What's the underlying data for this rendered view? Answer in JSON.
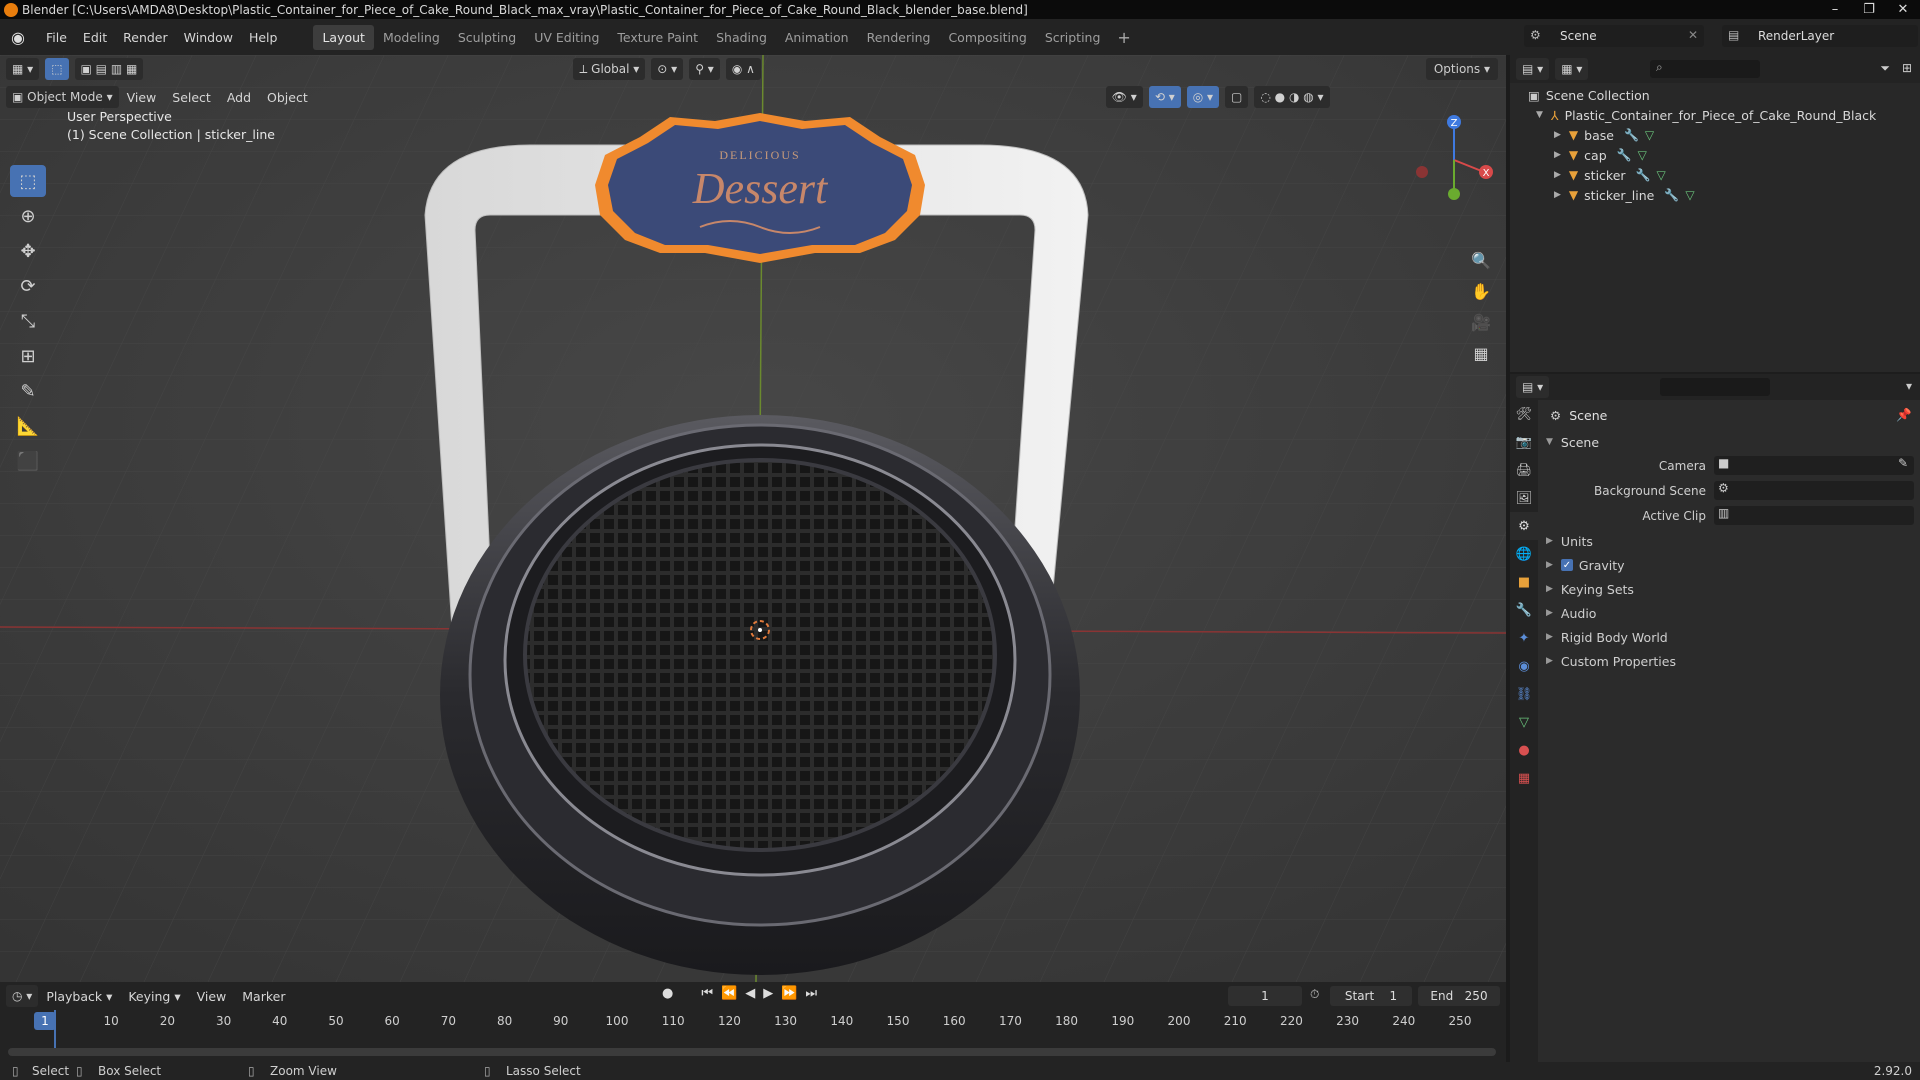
{
  "window": {
    "title": "Blender [C:\\Users\\AMDA8\\Desktop\\Plastic_Container_for_Piece_of_Cake_Round_Black_max_vray\\Plastic_Container_for_Piece_of_Cake_Round_Black_blender_base.blend]",
    "minimize": "–",
    "maximize": "❐",
    "close": "✕"
  },
  "menubar": {
    "items": [
      "File",
      "Edit",
      "Render",
      "Window",
      "Help"
    ],
    "workspaces": [
      "Layout",
      "Modeling",
      "Sculpting",
      "UV Editing",
      "Texture Paint",
      "Shading",
      "Animation",
      "Rendering",
      "Compositing",
      "Scripting"
    ],
    "add_workspace": "+",
    "scene": "Scene",
    "render_layer": "RenderLayer"
  },
  "viewport": {
    "mode": "Object Mode",
    "menus": [
      "View",
      "Select",
      "Add",
      "Object"
    ],
    "transform_orientation": "Global",
    "options": "Options",
    "info_line1": "User Perspective",
    "info_line2": "(1) Scene Collection | sticker_line",
    "sticker_top": "DELICIOUS",
    "sticker_main": "Dessert",
    "gizmo": {
      "z": "Z",
      "x": "X"
    }
  },
  "outliner": {
    "root": "Scene Collection",
    "collection": "Plastic_Container_for_Piece_of_Cake_Round_Black",
    "objects": [
      "base",
      "cap",
      "sticker",
      "sticker_line"
    ]
  },
  "properties": {
    "title": "Scene",
    "section": "Scene",
    "fields": [
      {
        "label": "Camera"
      },
      {
        "label": "Background Scene"
      },
      {
        "label": "Active Clip"
      }
    ],
    "subsections": [
      "Units",
      "Gravity",
      "Keying Sets",
      "Audio",
      "Rigid Body World",
      "Custom Properties"
    ],
    "gravity_checked": true
  },
  "timeline": {
    "menus": [
      "Playback",
      "Keying",
      "View",
      "Marker"
    ],
    "current_frame": "1",
    "start_label": "Start",
    "start": "1",
    "end_label": "End",
    "end": "250",
    "ruler": [
      "10",
      "20",
      "30",
      "40",
      "50",
      "60",
      "70",
      "80",
      "90",
      "100",
      "110",
      "120",
      "130",
      "140",
      "150",
      "160",
      "170",
      "180",
      "190",
      "200",
      "210",
      "220",
      "230",
      "240",
      "250"
    ],
    "cursor_frame": "1"
  },
  "statusbar": {
    "select": "Select",
    "box_select": "Box Select",
    "zoom_view": "Zoom View",
    "lasso_select": "Lasso Select",
    "version": "2.92.0"
  },
  "colors": {
    "accent": "#4772b3",
    "object_orange": "#e8a13a",
    "sticker_blue": "#3b4a78",
    "sticker_orange": "#f08a2e"
  }
}
